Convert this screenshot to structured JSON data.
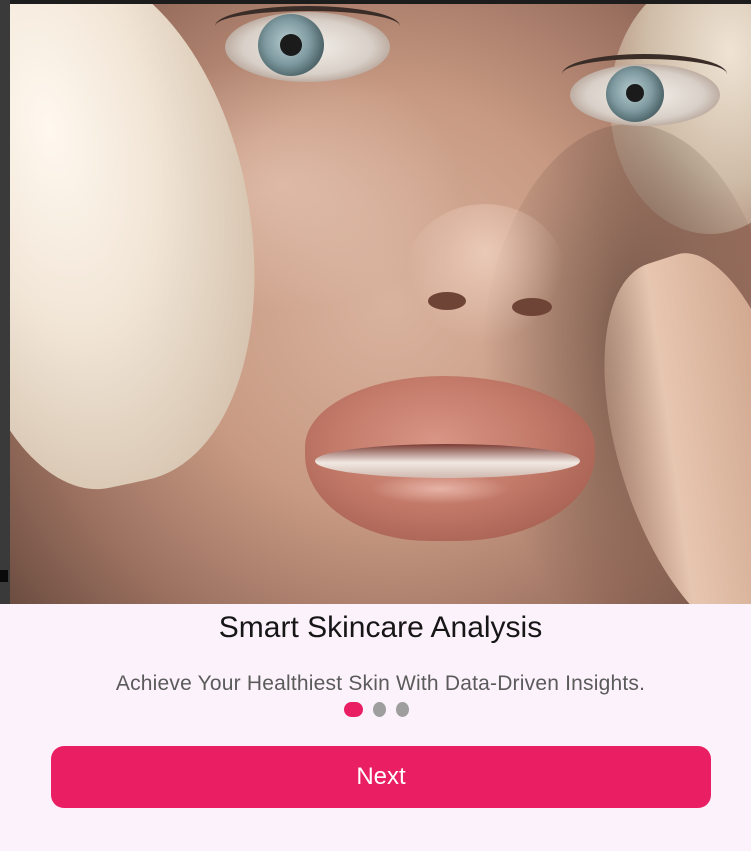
{
  "onboarding": {
    "title": "Smart Skincare Analysis",
    "subtitle": "Achieve Your Healthiest Skin With Data-Driven Insights.",
    "page_indicator": {
      "total_pages": 3,
      "current_page": 1
    },
    "next_label": "Next"
  },
  "colors": {
    "accent": "#e91e63",
    "background": "#fcf2fb",
    "inactive_dot": "#9e9e9e",
    "title_text": "#161616",
    "subtitle_text": "#5b5b5b"
  }
}
